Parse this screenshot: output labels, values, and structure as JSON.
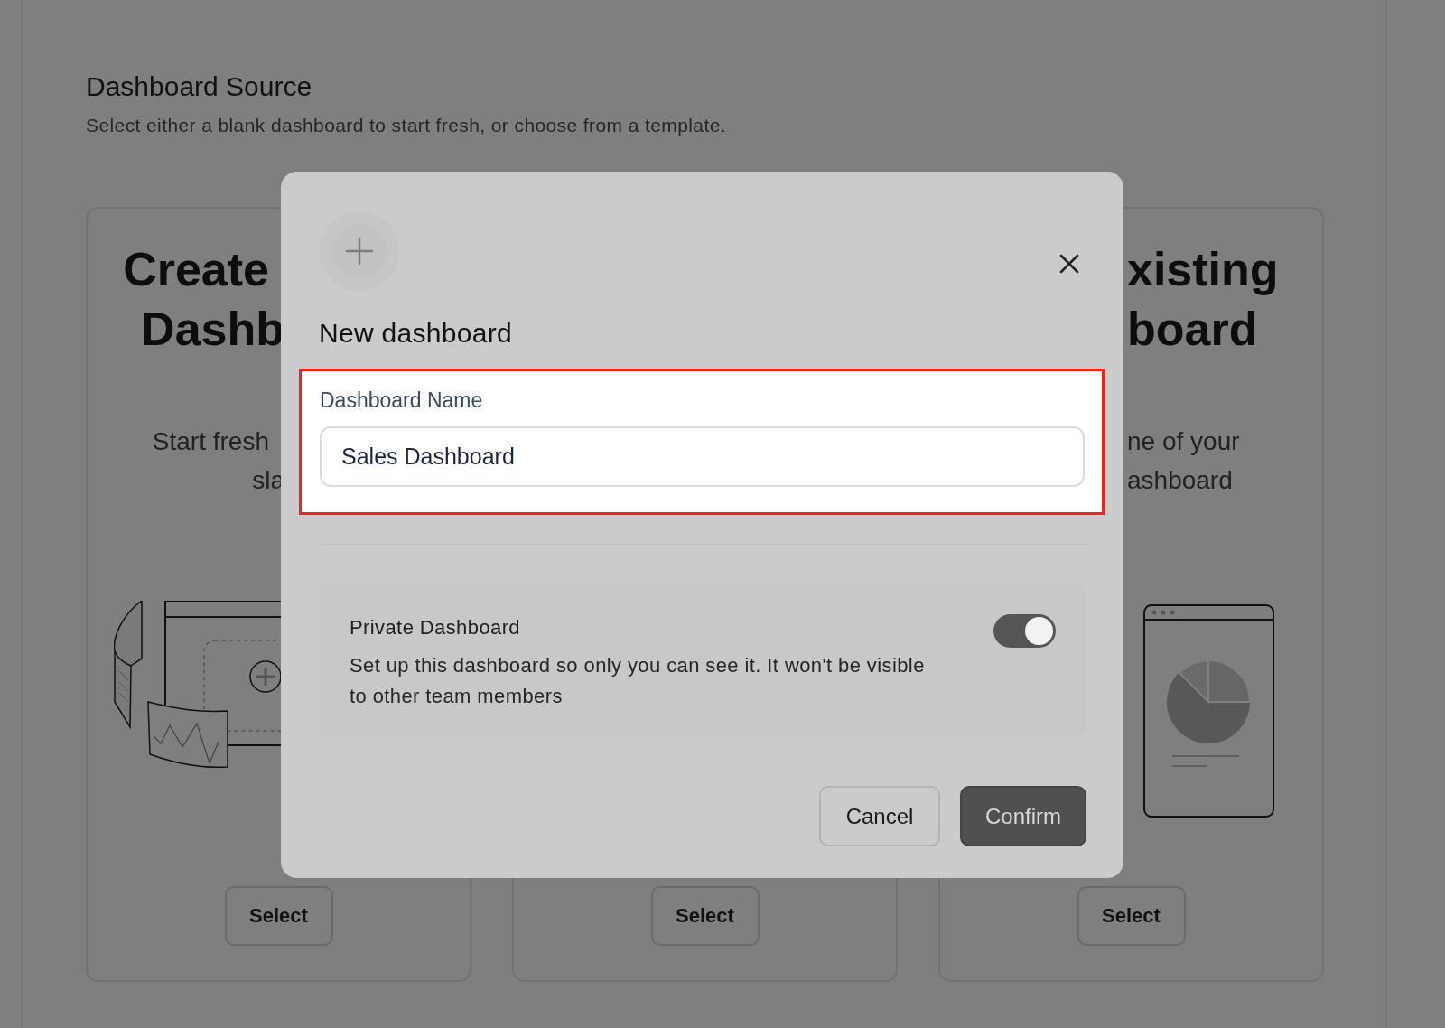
{
  "background": {
    "heading": "Dashboard Source",
    "subheading": "Select either a blank dashboard to start fresh, or choose from a template.",
    "cards": [
      {
        "kind": "blank",
        "title_lines": [
          "Create",
          "Dashb"
        ],
        "description_lines": [
          "Start fresh",
          "sla"
        ],
        "button": "Select"
      },
      {
        "kind": "template",
        "button": "Select"
      },
      {
        "kind": "existing",
        "title_lines": [
          "xisting",
          "board"
        ],
        "description_lines": [
          "ne of your",
          "ashboard"
        ],
        "button": "Select"
      }
    ]
  },
  "modal": {
    "title": "New dashboard",
    "field": {
      "label": "Dashboard Name",
      "value": "Sales Dashboard",
      "highlighted": true
    },
    "private_setting": {
      "title": "Private Dashboard",
      "description": "Set up this dashboard so only you can see it. It won't be visible to other team members",
      "on": true
    },
    "buttons": [
      {
        "kind": "secondary",
        "label": "Cancel"
      },
      {
        "kind": "primary",
        "label": "Confirm"
      }
    ]
  }
}
